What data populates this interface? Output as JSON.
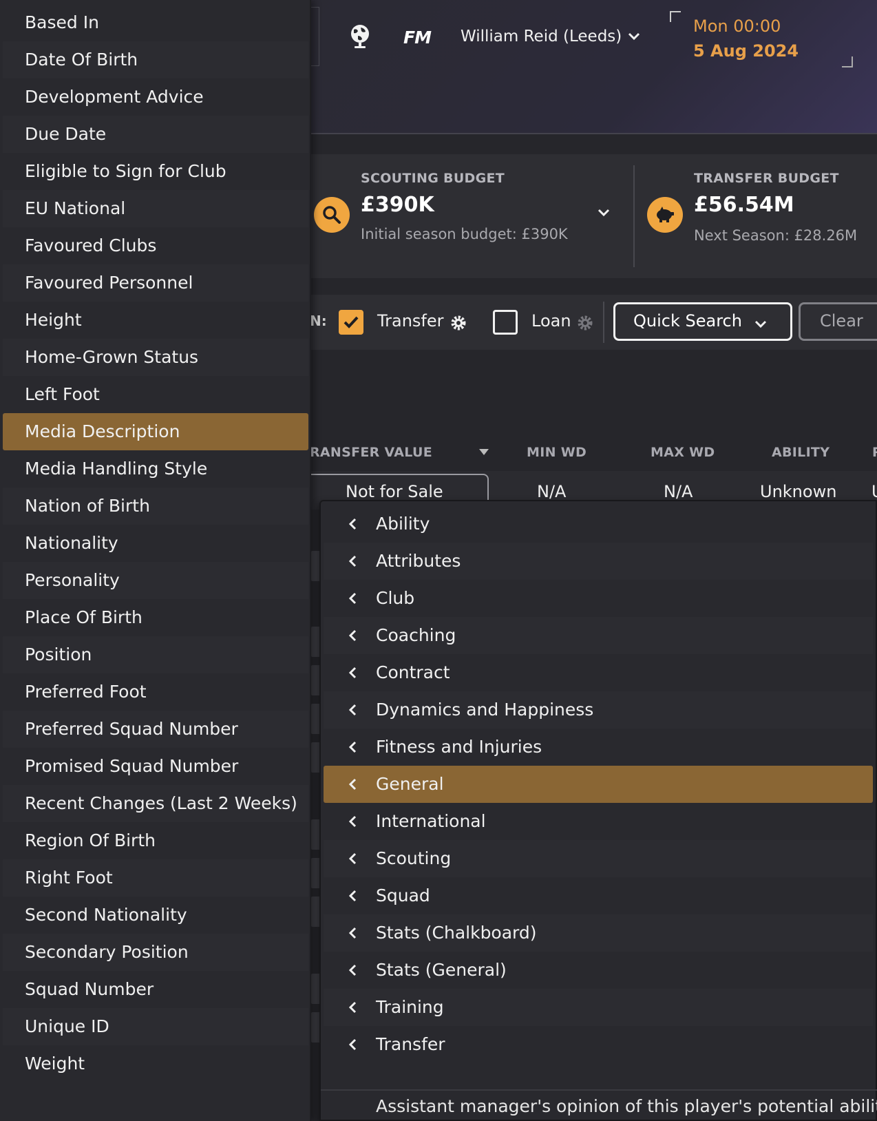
{
  "header": {
    "logo": "FM",
    "manager_name": "William Reid (Leeds)",
    "time": "Mon 00:00",
    "date": "5 Aug 2024"
  },
  "budgets": {
    "scouting": {
      "label": "SCOUTING BUDGET",
      "value": "£390K",
      "sub": "Initial season budget: £390K",
      "icon": "search-icon"
    },
    "transfer": {
      "label": "TRANSFER BUDGET",
      "value": "£56.54M",
      "sub": "Next Season: £28.26M",
      "icon": "piggy-bank-icon"
    }
  },
  "filters": {
    "prefix": "N:",
    "transfer_label": "Transfer",
    "transfer_checked": true,
    "loan_label": "Loan",
    "loan_checked": false,
    "quick_search_label": "Quick Search",
    "clear_label": "Clear"
  },
  "table": {
    "headers": [
      "RANSFER VALUE",
      "MIN WD",
      "MAX WD",
      "ABILITY",
      "P"
    ],
    "row": [
      "Not for Sale",
      "N/A",
      "N/A",
      "Unknown",
      "U"
    ]
  },
  "left_menu": {
    "selected": "Media Description",
    "items": [
      "Based In",
      "Date Of Birth",
      "Development Advice",
      "Due Date",
      "Eligible to Sign for Club",
      "EU National",
      "Favoured Clubs",
      "Favoured Personnel",
      "Height",
      "Home-Grown Status",
      "Left Foot",
      "Media Description",
      "Media Handling Style",
      "Nation of Birth",
      "Nationality",
      "Personality",
      "Place Of Birth",
      "Position",
      "Preferred Foot",
      "Preferred Squad Number",
      "Promised Squad Number",
      "Recent Changes (Last 2 Weeks)",
      "Region Of Birth",
      "Right Foot",
      "Second Nationality",
      "Secondary Position",
      "Squad Number",
      "Unique ID",
      "Weight"
    ]
  },
  "sub_menu": {
    "selected": "General",
    "items": [
      "Ability",
      "Attributes",
      "Club",
      "Coaching",
      "Contract",
      "Dynamics and Happiness",
      "Fitness and Injuries",
      "General",
      "International",
      "Scouting",
      "Squad",
      "Stats (Chalkboard)",
      "Stats (General)",
      "Training",
      "Transfer"
    ],
    "hint": "Assistant manager's opinion of this player's potential ability"
  },
  "colors": {
    "accent": "#f0a640",
    "date_text": "#e8a04a",
    "selected_row": "#8a6634",
    "menu_bg": "#29292e"
  }
}
